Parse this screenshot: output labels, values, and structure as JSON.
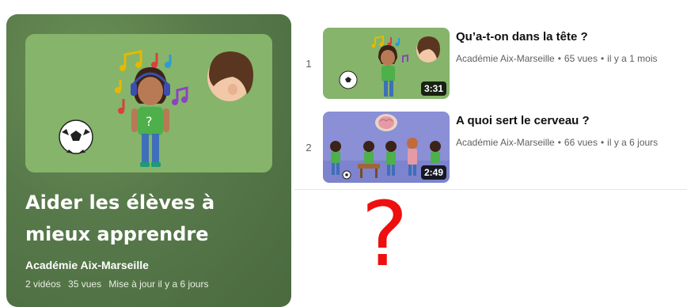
{
  "playlist": {
    "title": "Aider les élèves à mieux apprendre",
    "channel": "Académie Aix-Marseille",
    "video_count": "2 vidéos",
    "views": "35 vues",
    "updated": "Mise à jour il y a 6 jours"
  },
  "videos": [
    {
      "index": "1",
      "title": "Qu’a-t-on dans la tête ?",
      "channel": "Académie Aix-Marseille",
      "views": "65 vues",
      "age": "il y a 1 mois",
      "duration": "3:31"
    },
    {
      "index": "2",
      "title": "A quoi sert le cerveau ?",
      "channel": "Académie Aix-Marseille",
      "views": "66 vues",
      "age": "il y a 6 jours",
      "duration": "2:49"
    }
  ],
  "separator_dot": "•",
  "overlay_mark": "?",
  "colors": {
    "panel_green": "#57794a",
    "thumb_green": "#86b46a",
    "thumb_purple": "#8a8fd6",
    "question_red": "#ee0f0f"
  }
}
